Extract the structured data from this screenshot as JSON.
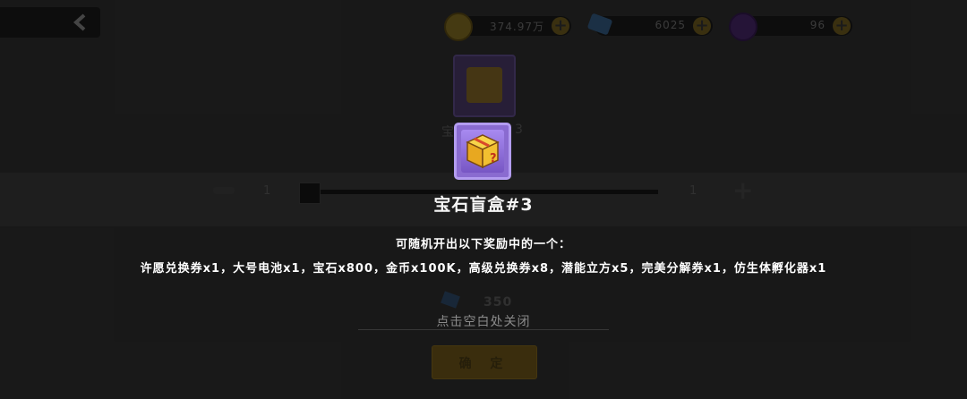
{
  "resources": {
    "coins": "374.97万",
    "gems": "6025",
    "orbs": "96"
  },
  "shop": {
    "item_name_left": "宝",
    "item_name_right": "3",
    "qty_left": "1",
    "qty_right": "1",
    "price": "350",
    "confirm_label": "确 定"
  },
  "popup": {
    "title": "宝石盲盒#3",
    "subtitle": "可随机开出以下奖励中的一个：",
    "description": "许愿兑换券x1，大号电池x1，宝石x800，金币x100K，高级兑换券x8，潜能立方x5，完美分解券x1，仿生体孵化器x1",
    "close_hint": "点击空白处关闭"
  },
  "colors": {
    "accent_gold": "#e8b420",
    "card_purple": "#8a6bd0"
  }
}
